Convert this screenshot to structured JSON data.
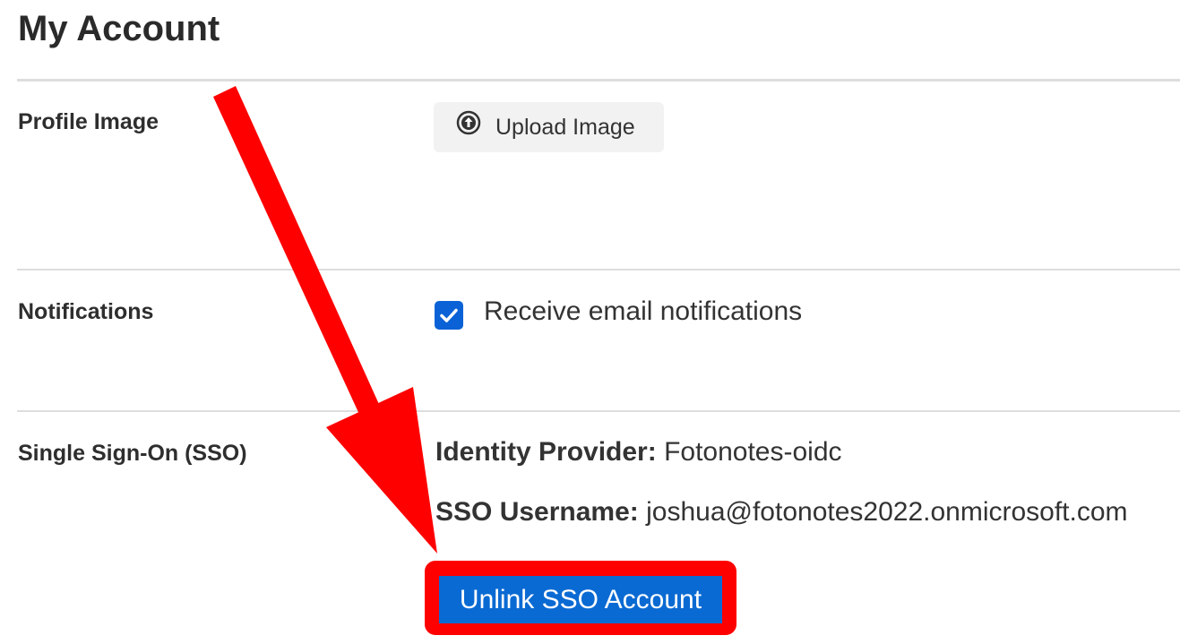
{
  "page": {
    "title": "My Account"
  },
  "profile": {
    "label": "Profile Image",
    "upload_label": "Upload Image",
    "upload_icon": "upload-circle-icon"
  },
  "notifications": {
    "label": "Notifications",
    "checkbox_label": "Receive email notifications",
    "checked": true,
    "accent_color": "#0b62d6"
  },
  "sso": {
    "label": "Single Sign-On (SSO)",
    "provider_key": "Identity Provider:",
    "provider_value": "Fotonotes-oidc",
    "username_key": "SSO Username:",
    "username_value": "joshua@fotonotes2022.onmicrosoft.com",
    "unlink_label": "Unlink SSO Account",
    "button_color": "#0a6ad3"
  },
  "annotation": {
    "color": "#ff0000",
    "icon": "red-arrow-icon"
  }
}
